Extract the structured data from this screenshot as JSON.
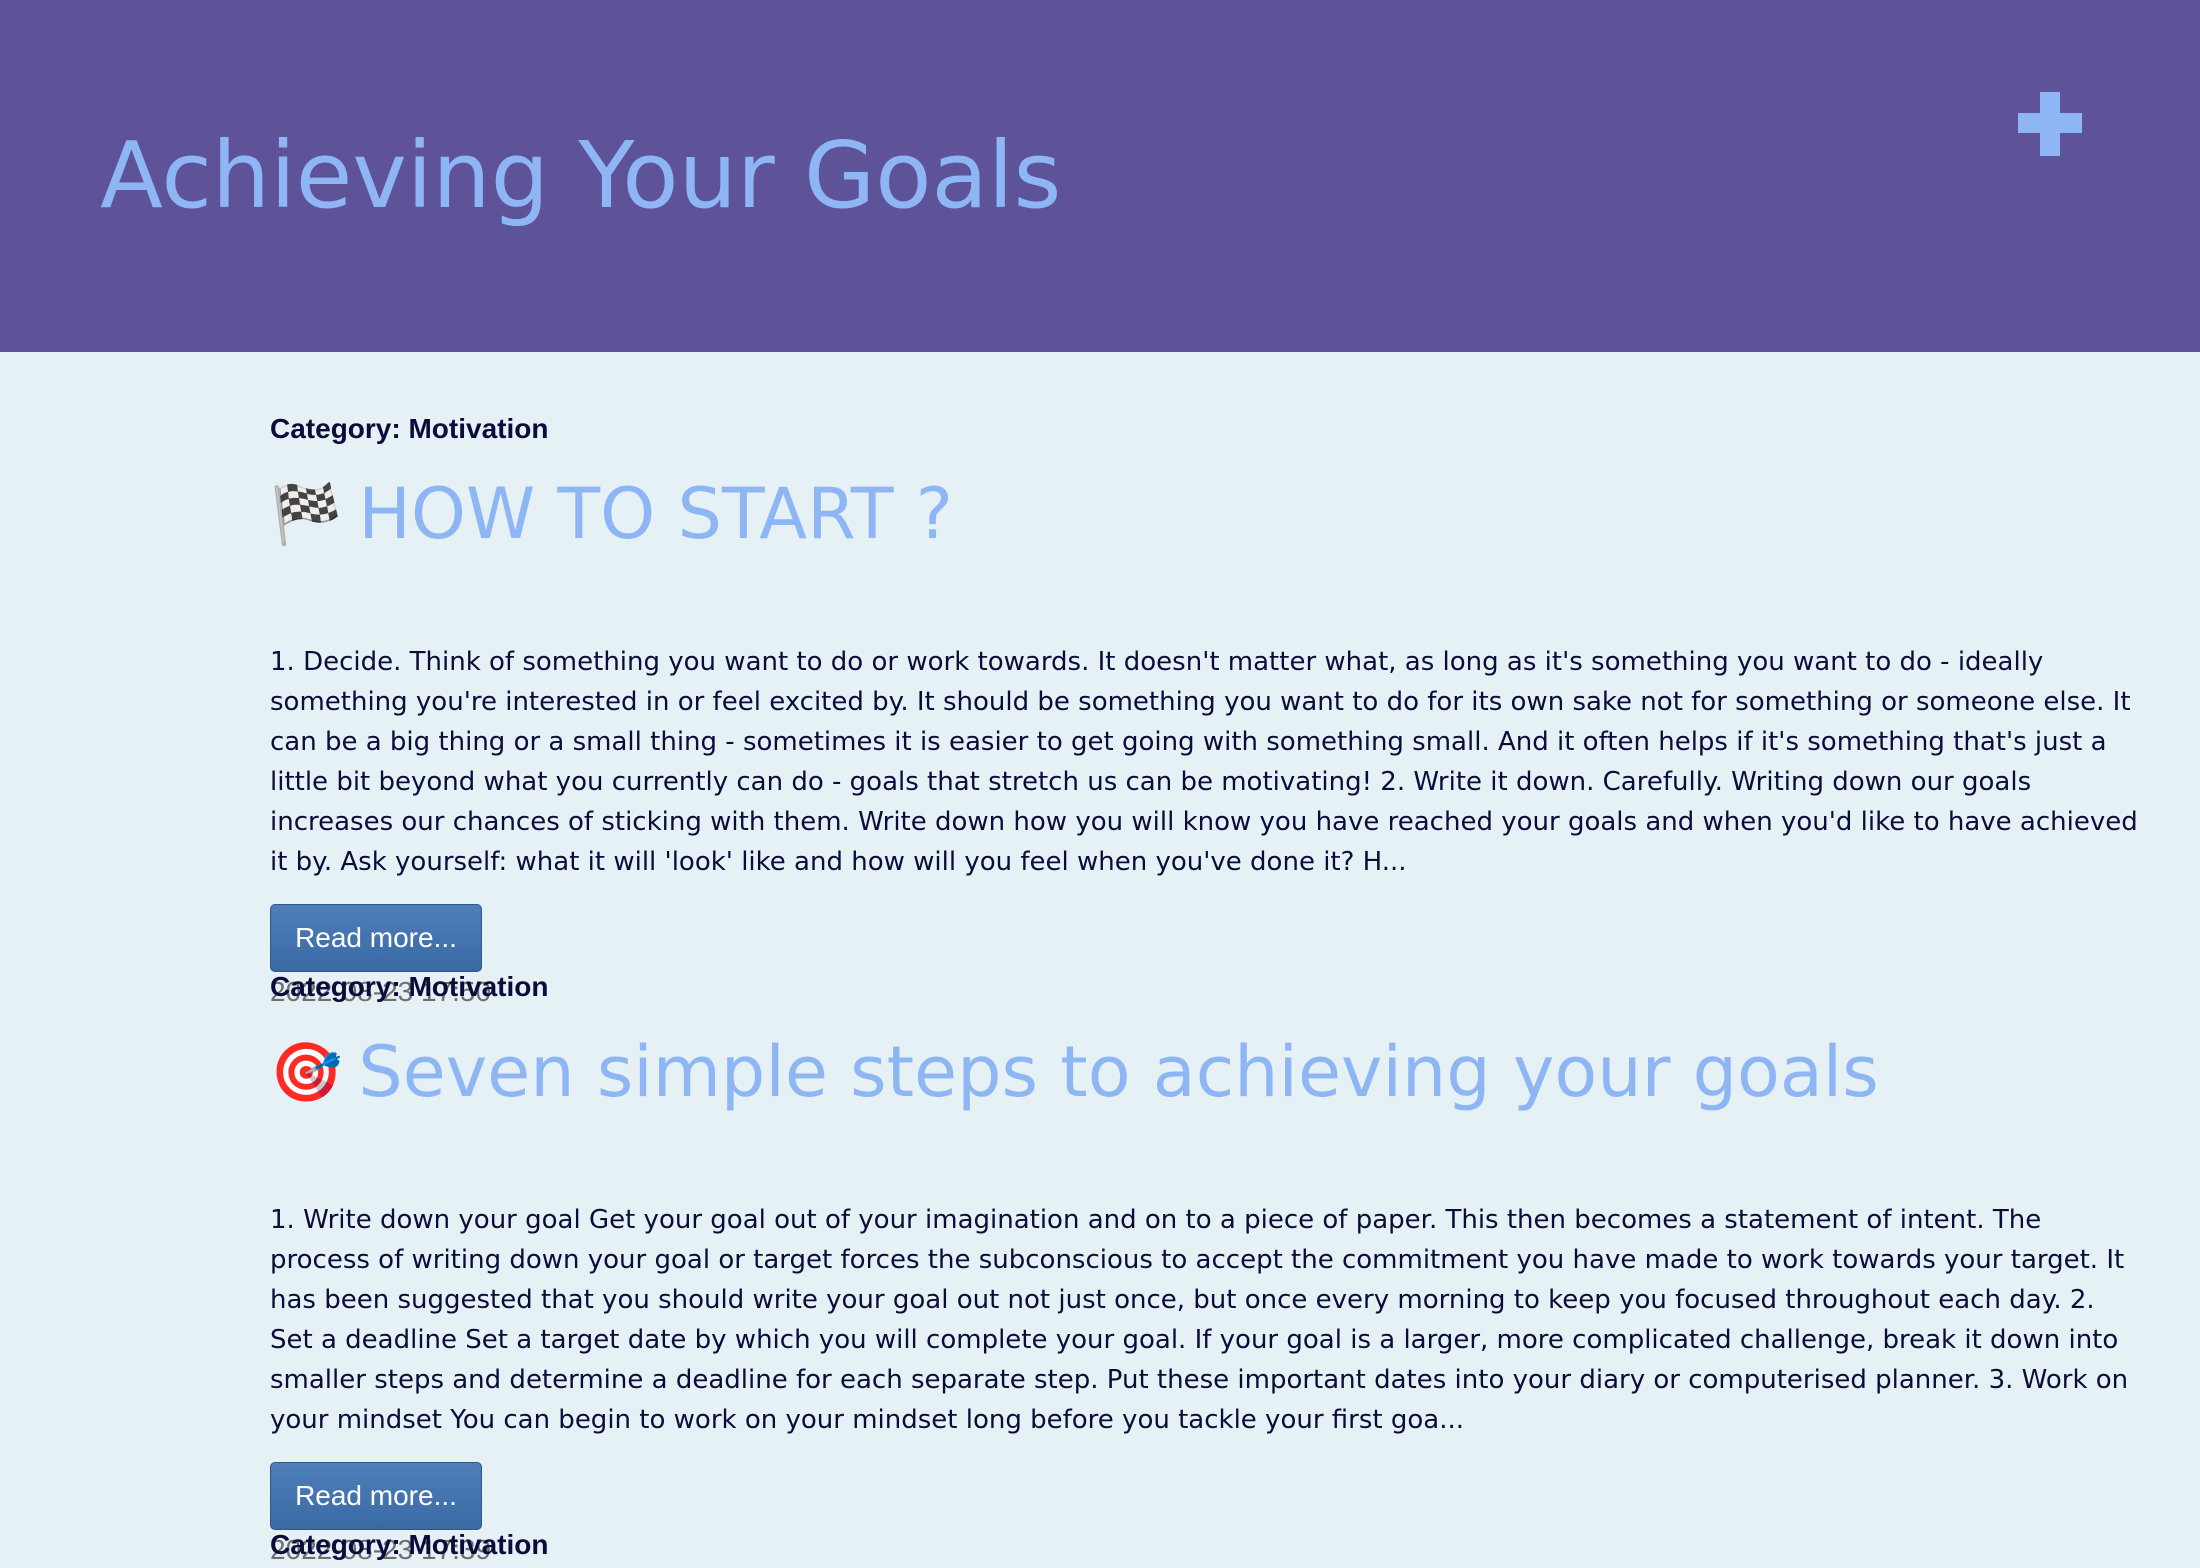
{
  "header": {
    "title": "Achieving Your Goals",
    "add_icon": "plus-icon"
  },
  "posts": [
    {
      "category": "Category: Motivation",
      "emoji": "🏁",
      "emoji_icon": "checkered-flag-icon",
      "title": "HOW TO START ?",
      "excerpt": "1. Decide. Think of something you want to do or work towards. It doesn't matter what, as long as it's something you want to do - ideally something you're interested in or feel excited by. It should be something you want to do for its own sake not for something or someone else. It can be a big thing or a small thing - sometimes it is easier to get going with something small. And it often helps if it's something that's just a little bit beyond what you currently can do - goals that stretch us can be motivating! 2. Write it down. Carefully. Writing down our goals increases our chances of sticking with them. Write down how you will know you have reached your goals and when you'd like to have achieved it by. Ask yourself: what it will 'look' like and how will you feel when you've done it? H...",
      "read_more": "Read more...",
      "timestamp": "2022-08-23 17:50"
    },
    {
      "category": "Category: Motivation",
      "emoji": "🎯",
      "emoji_icon": "direct-hit-target-icon",
      "title": "Seven simple steps to achieving your goals",
      "excerpt": "1. Write down your goal Get your goal out of your imagination and on to a piece of paper. This then becomes a statement of intent. The process of writing down your goal or target forces the subconscious to accept the commitment you have made to work towards your target. It has been suggested that you should write your goal out not just once, but once every morning to keep you focused throughout each day. 2. Set a deadline Set a target date by which you will complete your goal. If your goal is a larger, more complicated challenge, break it down into smaller steps and determine a deadline for each separate step. Put these important dates into your diary or computerised planner. 3. Work on your mindset You can begin to work on your mindset long before you tackle your first goa...",
      "read_more": "Read more...",
      "timestamp": "2022-08-23 17:39"
    },
    {
      "category": "Category: Motivation"
    }
  ],
  "colors": {
    "header_bg": "#5e5299",
    "title": "#8fb6f4",
    "page_bg": "#e6f1f6",
    "text": "#0c0c3a",
    "button": "#4a78b0",
    "timestamp": "#6f6f6f"
  }
}
